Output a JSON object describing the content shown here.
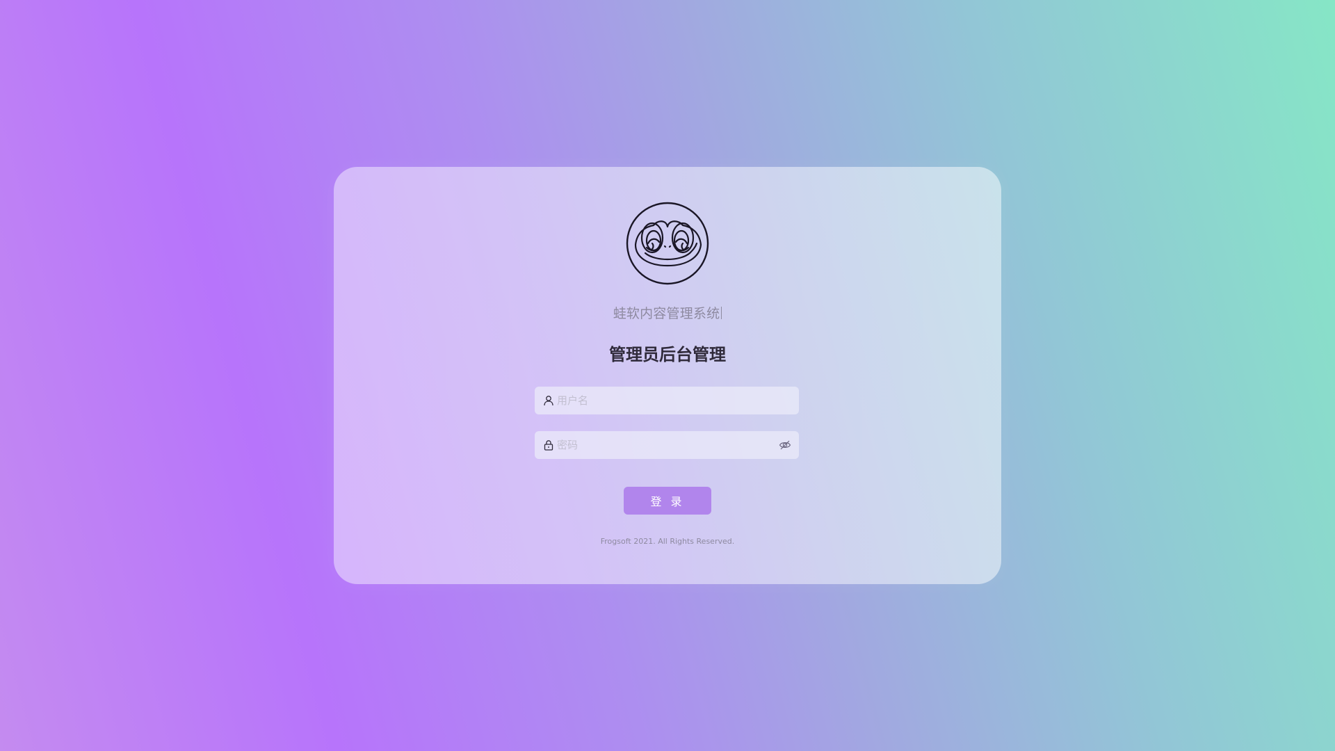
{
  "app": {
    "subtitle": "蛙软内容管理系统",
    "title": "管理员后台管理"
  },
  "form": {
    "username_placeholder": "用户名",
    "username_value": "",
    "password_placeholder": "密码",
    "password_value": "",
    "login_label": "登 录"
  },
  "footer": {
    "copyright": "Frogsoft 2021. All Rights Reserved."
  },
  "icons": {
    "logo": "frog-logo-icon",
    "username": "user-icon",
    "password": "lock-icon",
    "toggle_password": "eye-off-icon"
  },
  "colors": {
    "accent": "#b185ec",
    "title": "#2f2a3a",
    "muted": "#8e8aa0"
  }
}
